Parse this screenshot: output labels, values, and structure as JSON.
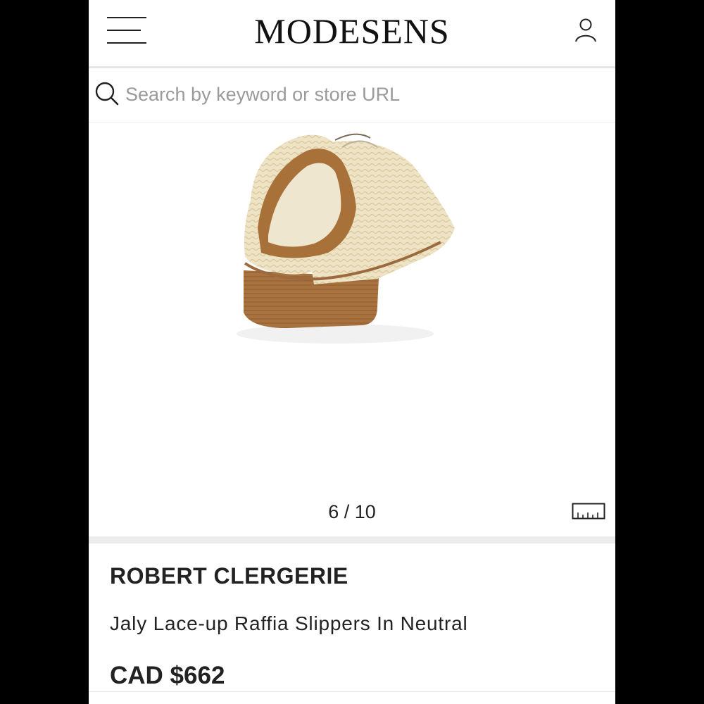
{
  "header": {
    "logo": "MODESENS",
    "menu_icon": "hamburger-menu-icon",
    "account_icon": "user-icon"
  },
  "search": {
    "placeholder": "Search by keyword or store URL",
    "value": "",
    "icon": "search-icon"
  },
  "gallery": {
    "counter": "6 / 10",
    "size_guide_icon": "ruler-icon",
    "image_subject": "raffia-slipper-shoe"
  },
  "product": {
    "brand": "ROBERT CLERGERIE",
    "name": "Jaly Lace-up Raffia Slippers In Neutral",
    "price": "CAD $662"
  },
  "colors": {
    "background": "#000000",
    "page": "#ffffff",
    "text": "#222222",
    "placeholder": "#9a9a9a",
    "raffia": "#eadfbe",
    "heel": "#9c6a3f"
  }
}
